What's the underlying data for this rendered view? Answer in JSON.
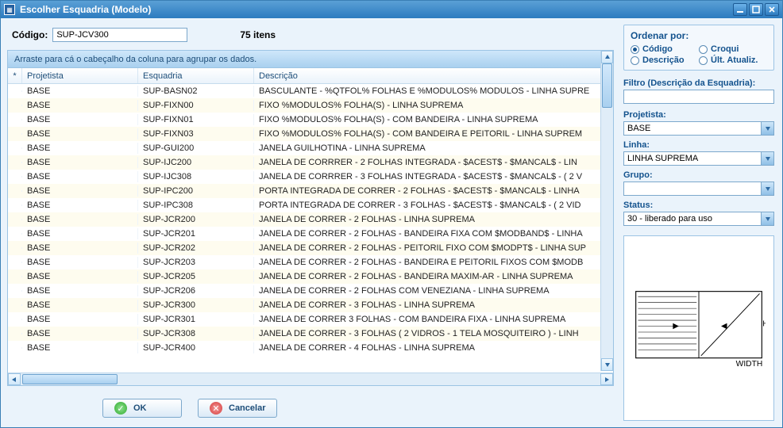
{
  "window": {
    "title": "Escolher Esquadria (Modelo)"
  },
  "codigo": {
    "label": "Código:",
    "value": "SUP-JCV300",
    "count": "75 itens"
  },
  "grid": {
    "group_hint": "Arraste para cá o cabeçalho da coluna para agrupar os dados.",
    "star": "*",
    "cols": {
      "projetista": "Projetista",
      "esquadria": "Esquadria",
      "descricao": "Descrição"
    },
    "rows": [
      {
        "proj": "BASE",
        "esq": "SUP-BASN02",
        "desc": "BASCULANTE - %QTFOL% FOLHAS E %MODULOS% MODULOS - LINHA SUPRE"
      },
      {
        "proj": "BASE",
        "esq": "SUP-FIXN00",
        "desc": "FIXO %MODULOS% FOLHA(S) - LINHA SUPREMA"
      },
      {
        "proj": "BASE",
        "esq": "SUP-FIXN01",
        "desc": "FIXO %MODULOS% FOLHA(S) - COM BANDEIRA - LINHA SUPREMA"
      },
      {
        "proj": "BASE",
        "esq": "SUP-FIXN03",
        "desc": "FIXO %MODULOS% FOLHA(S) - COM BANDEIRA E PEITORIL - LINHA SUPREM"
      },
      {
        "proj": "BASE",
        "esq": "SUP-GUI200",
        "desc": "JANELA GUILHOTINA - LINHA SUPREMA"
      },
      {
        "proj": "BASE",
        "esq": "SUP-IJC200",
        "desc": "JANELA DE CORRRER - 2 FOLHAS INTEGRADA - $ACEST$ - $MANCAL$ - LIN"
      },
      {
        "proj": "BASE",
        "esq": "SUP-IJC308",
        "desc": "JANELA DE CORRRER - 3 FOLHAS INTEGRADA - $ACEST$ - $MANCAL$ - ( 2 V"
      },
      {
        "proj": "BASE",
        "esq": "SUP-IPC200",
        "desc": "PORTA INTEGRADA DE CORRER - 2 FOLHAS - $ACEST$ - $MANCAL$ -  LINHA"
      },
      {
        "proj": "BASE",
        "esq": "SUP-IPC308",
        "desc": "PORTA INTEGRADA DE CORRER - 3 FOLHAS - $ACEST$ - $MANCAL$ - ( 2 VID"
      },
      {
        "proj": "BASE",
        "esq": "SUP-JCR200",
        "desc": "JANELA DE CORRER - 2 FOLHAS - LINHA SUPREMA"
      },
      {
        "proj": "BASE",
        "esq": "SUP-JCR201",
        "desc": "JANELA DE CORRER - 2 FOLHAS - BANDEIRA FIXA COM $MODBAND$ - LINHA"
      },
      {
        "proj": "BASE",
        "esq": "SUP-JCR202",
        "desc": "JANELA DE CORRER - 2 FOLHAS - PEITORIL FIXO COM $MODPT$ - LINHA SUP"
      },
      {
        "proj": "BASE",
        "esq": "SUP-JCR203",
        "desc": "JANELA DE CORRER - 2 FOLHAS - BANDEIRA  E PEITORIL FIXOS COM $MODB"
      },
      {
        "proj": "BASE",
        "esq": "SUP-JCR205",
        "desc": "JANELA DE CORRER - 2 FOLHAS - BANDEIRA MAXIM-AR - LINHA SUPREMA"
      },
      {
        "proj": "BASE",
        "esq": "SUP-JCR206",
        "desc": "JANELA DE CORRER - 2 FOLHAS COM VENEZIANA - LINHA SUPREMA"
      },
      {
        "proj": "BASE",
        "esq": "SUP-JCR300",
        "desc": "JANELA DE CORRER - 3 FOLHAS - LINHA SUPREMA"
      },
      {
        "proj": "BASE",
        "esq": "SUP-JCR301",
        "desc": "JANELA DE CORRER 3 FOLHAS - COM BANDEIRA FIXA - LINHA SUPREMA"
      },
      {
        "proj": "BASE",
        "esq": "SUP-JCR308",
        "desc": "JANELA DE CORRER - 3 FOLHAS ( 2 VIDROS -  1 TELA MOSQUITEIRO ) - LINH"
      },
      {
        "proj": "BASE",
        "esq": "SUP-JCR400",
        "desc": "JANELA DE CORRER - 4 FOLHAS - LINHA SUPREMA"
      }
    ]
  },
  "buttons": {
    "ok": "OK",
    "cancel": "Cancelar"
  },
  "sort": {
    "title": "Ordenar por:",
    "codigo": "Código",
    "croqui": "Croqui",
    "descricao": "Descrição",
    "ultatual": "Últ. Atualiz.",
    "selected": "codigo"
  },
  "filters": {
    "filtro_label": "Filtro (Descrição da Esquadria):",
    "filtro_value": "",
    "projetista_label": "Projetista:",
    "projetista_value": "BASE",
    "linha_label": "Linha:",
    "linha_value": "LINHA SUPREMA",
    "grupo_label": "Grupo:",
    "grupo_value": "",
    "status_label": "Status:",
    "status_value": "30 - liberado para uso"
  },
  "preview": {
    "hlabel": "H",
    "wlabel": "WIDTH"
  }
}
